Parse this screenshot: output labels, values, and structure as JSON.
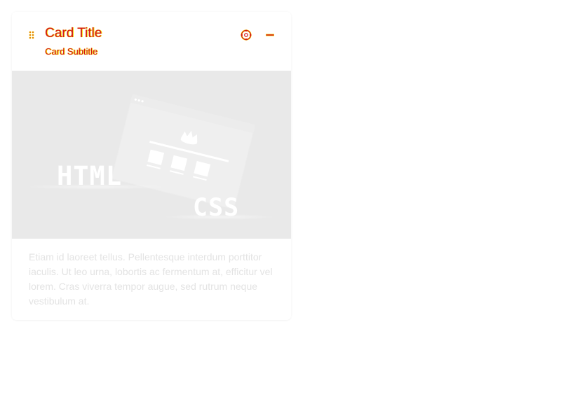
{
  "card": {
    "title": "Card Title",
    "subtitle": "Card Subtitle",
    "body_text": "Etiam id laoreet tellus. Pellentesque interdum porttitor iaculis. Ut leo urna, lobortis ac fermentum at, efficitur vel lorem. Cras viverra tempor augue, sed rutrum neque vestibulum at.",
    "actions": [
      {
        "icon": "settings-icon"
      },
      {
        "icon": "collapse-icon"
      }
    ],
    "drag_icon": "drag-handle-icon"
  },
  "media": {
    "labels": {
      "html": "HTML",
      "css": "CSS"
    }
  },
  "colors": {
    "title_text": "#d41616",
    "title_glow": "#f4de00",
    "media_bg": "#e9e9e9",
    "body_text": "#e3e3e3"
  }
}
